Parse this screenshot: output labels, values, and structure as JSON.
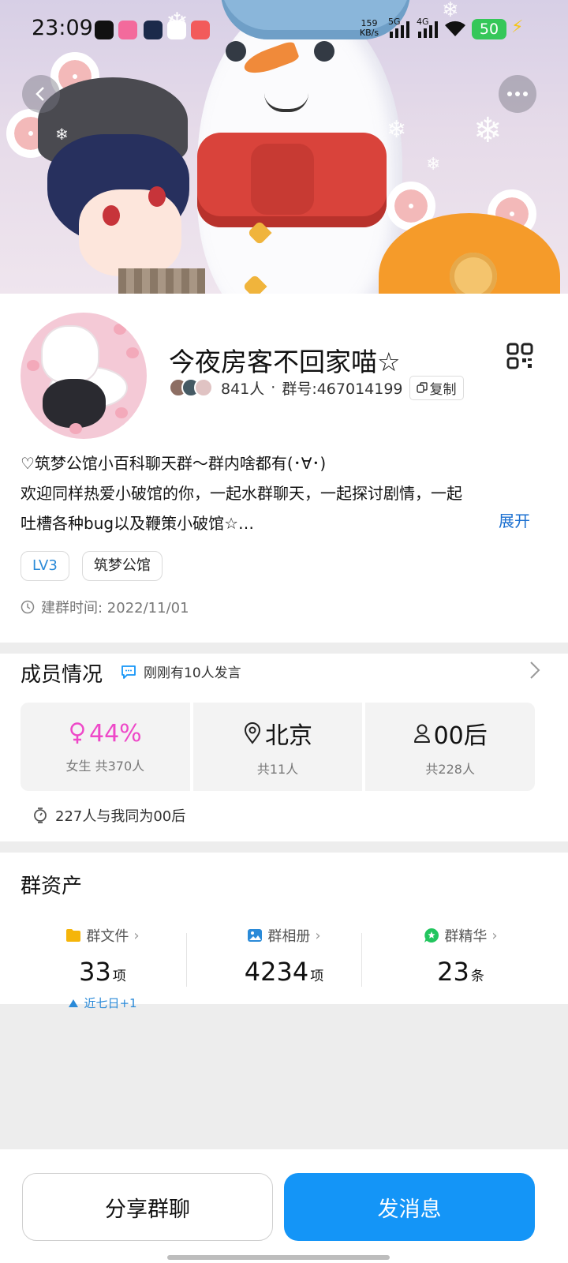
{
  "status_bar": {
    "time": "23:09",
    "net_speed_value": "159",
    "net_speed_unit": "KB/s",
    "sim1_label": "5G",
    "sim2_label": "4G",
    "battery": "50",
    "app_icons": [
      "tiktok-icon",
      "bilibili-icon",
      "bot-app-icon",
      "video-play-icon",
      "notes-app-icon"
    ]
  },
  "group": {
    "name": "今夜房客不回家喵☆",
    "member_count": "841人",
    "separator": "·",
    "group_number": "群号:467014199",
    "copy_label": "复制",
    "description_lines": [
      "♡筑梦公馆小百科聊天群～群内啥都有(･∀･)",
      "欢迎同样热爱小破馆的你，一起水群聊天，一起探讨剧情，一起",
      "吐槽各种bug以及鞭策小破馆☆…"
    ],
    "expand_label": "展开",
    "tags": [
      "LV3",
      "筑梦公馆"
    ],
    "created": "建群时间: 2022/11/01"
  },
  "members": {
    "title": "成员情况",
    "recent": "刚刚有10人发言",
    "stats": [
      {
        "icon": "female-icon",
        "value": "44%",
        "sub": "女生 共370人"
      },
      {
        "icon": "location-pin-icon",
        "value": "北京",
        "sub": "共11人"
      },
      {
        "icon": "person-icon",
        "value": "00后",
        "sub": "共228人"
      }
    ],
    "same_age": "227人与我同为00后"
  },
  "assets": {
    "title": "群资产",
    "items": [
      {
        "icon": "folder-icon",
        "label": "群文件",
        "count": "33",
        "unit": "项",
        "trend": "近七日+1"
      },
      {
        "icon": "image-icon",
        "label": "群相册",
        "count": "4234",
        "unit": "项"
      },
      {
        "icon": "essence-icon",
        "label": "群精华",
        "count": "23",
        "unit": "条"
      }
    ]
  },
  "bottom": {
    "share_label": "分享群聊",
    "send_label": "发消息"
  },
  "colors": {
    "accent_blue": "#1495f7",
    "female_pink": "#ee48c8",
    "link_blue": "#1a6fd0",
    "tag_blue": "#2a8ad8"
  }
}
